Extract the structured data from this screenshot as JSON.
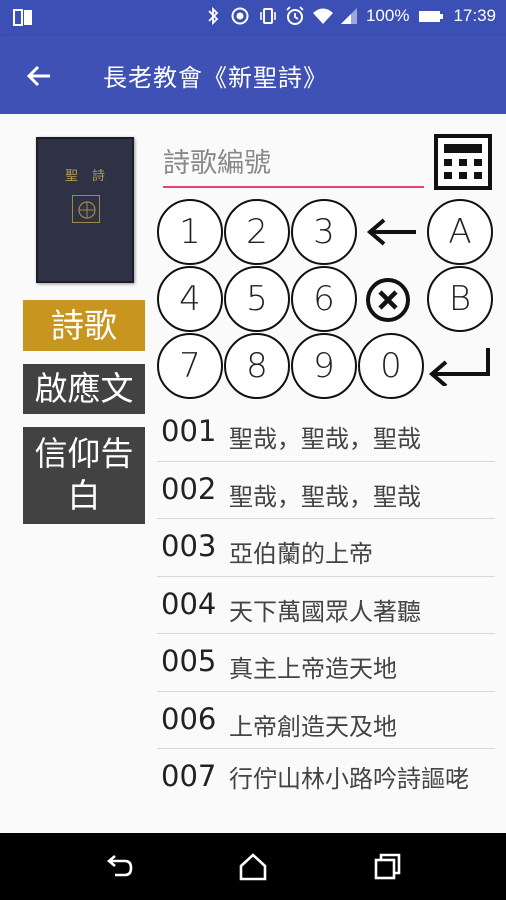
{
  "status": {
    "battery": "100%",
    "time": "17:39"
  },
  "appbar": {
    "title": "長老教會《新聖詩》"
  },
  "book": {
    "title": "聖詩"
  },
  "categories": [
    {
      "label": "詩歌"
    },
    {
      "label": "啟應文"
    },
    {
      "label": "信仰告白"
    }
  ],
  "search": {
    "placeholder": "詩歌編號",
    "value": ""
  },
  "keypad": {
    "digits": [
      "1",
      "2",
      "3",
      "4",
      "5",
      "6",
      "7",
      "8",
      "9",
      "0"
    ],
    "letters": [
      "A",
      "B"
    ],
    "backspace": "←",
    "clear": "⊗",
    "enter": "↵"
  },
  "songs": [
    {
      "number": "001",
      "title": "聖哉，聖哉，聖哉"
    },
    {
      "number": "002",
      "title": "聖哉，聖哉，聖哉"
    },
    {
      "number": "003",
      "title": "亞伯蘭的上帝"
    },
    {
      "number": "004",
      "title": "天下萬國眾人著聽"
    },
    {
      "number": "005",
      "title": "真主上帝造天地"
    },
    {
      "number": "006",
      "title": "上帝創造天及地"
    },
    {
      "number": "007",
      "title": "行佇山林小路吟詩謳咾"
    }
  ],
  "colors": {
    "primary": "#3f51b5",
    "accent": "#e0457b",
    "selected_category": "#c8961e",
    "category": "#424242"
  },
  "icons": {
    "back": "arrow-back-icon",
    "calculator": "calculator-icon",
    "nav_back": "nav-back-icon",
    "nav_home": "nav-home-icon",
    "nav_recents": "nav-recents-icon"
  }
}
